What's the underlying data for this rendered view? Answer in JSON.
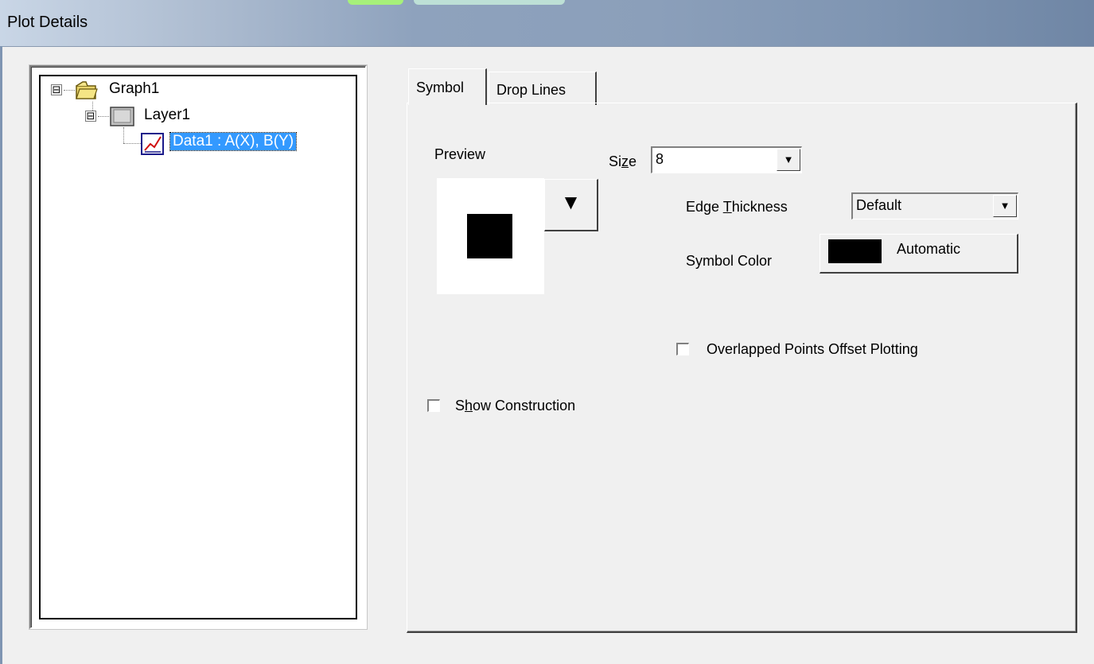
{
  "window": {
    "title": "Plot Details"
  },
  "tree": {
    "nodes": [
      {
        "label": "Graph1",
        "expander": "⊟",
        "icon": "folder-icon"
      },
      {
        "label": "Layer1",
        "expander": "⊟",
        "icon": "layer-icon"
      },
      {
        "label": "Data1 : A(X), B(Y)",
        "icon": "plot-icon",
        "selected": true
      }
    ]
  },
  "tabs": [
    {
      "label": "Symbol",
      "active": true
    },
    {
      "label": "Drop Lines",
      "active": false
    }
  ],
  "symbol": {
    "preview_label": "Preview",
    "size_label_pre": "Si",
    "size_label_u": "z",
    "size_label_post": "e",
    "size_value": "8",
    "edge_label_pre": "Edge ",
    "edge_label_u": "T",
    "edge_label_post": "hickness",
    "edge_value": "Default",
    "color_label": "Symbol Color",
    "color_button": "Automatic",
    "overlap_label": "Overlapped Points Offset Plotting",
    "show_label_pre": "S",
    "show_label_u": "h",
    "show_label_post": "ow Construction",
    "symbol_color": "#000000"
  }
}
